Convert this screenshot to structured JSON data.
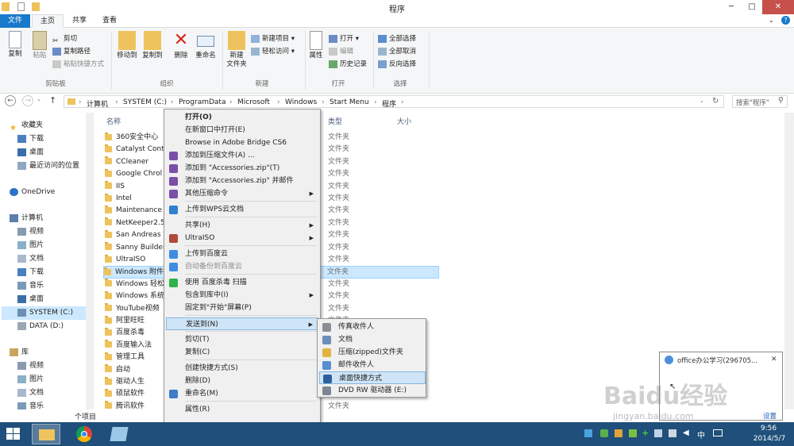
{
  "window": {
    "title": "程序",
    "min": "─",
    "max": "□",
    "close": "✕"
  },
  "tabs": [
    "文件",
    "主页",
    "共享",
    "查看"
  ],
  "ribbon": {
    "clipboard": {
      "copy": "复制",
      "paste": "粘贴",
      "cut": "剪切",
      "copy_path": "复制路径",
      "paste_shortcut": "粘贴快捷方式",
      "group": "剪贴板"
    },
    "organize": {
      "move_to": "移动到",
      "copy_to": "复制到",
      "delete": "删除",
      "rename": "重命名",
      "group": "组织"
    },
    "new": {
      "new_folder": "新建\n文件夹",
      "new_item": "新建项目",
      "easy_access": "轻松访问",
      "group": "新建"
    },
    "open": {
      "properties": "属性",
      "open": "打开",
      "edit": "编辑",
      "history": "历史记录",
      "group": "打开"
    },
    "select": {
      "select_all": "全部选择",
      "select_none": "全部取消",
      "invert": "反向选择",
      "group": "选择"
    }
  },
  "address": {
    "crumbs": [
      "计算机",
      "SYSTEM (C:)",
      "ProgramData",
      "Microsoft",
      "Windows",
      "Start Menu",
      "程序"
    ],
    "search_placeholder": "搜索\"程序\""
  },
  "nav": {
    "items": [
      "收藏夹",
      "下载",
      "桌面",
      "最近访问的位置",
      "OneDrive",
      "计算机",
      "视频",
      "图片",
      "文档",
      "下载",
      "音乐",
      "桌面",
      "SYSTEM (C:)",
      "DATA (D:)",
      "库",
      "视频",
      "图片",
      "文档",
      "音乐"
    ]
  },
  "columns": {
    "name": "名称",
    "type": "类型",
    "size": "大小"
  },
  "files": [
    {
      "name": "360安全中心",
      "type": "文件夹"
    },
    {
      "name": "Catalyst Cont",
      "type": "文件夹"
    },
    {
      "name": "CCleaner",
      "type": "文件夹"
    },
    {
      "name": "Google Chrol",
      "type": "文件夹"
    },
    {
      "name": "IIS",
      "type": "文件夹"
    },
    {
      "name": "Intel",
      "type": "文件夹"
    },
    {
      "name": "Maintenance",
      "type": "文件夹"
    },
    {
      "name": "NetKeeper2.5",
      "type": "文件夹"
    },
    {
      "name": "San Andreas",
      "type": "文件夹"
    },
    {
      "name": "Sanny Builder",
      "type": "文件夹"
    },
    {
      "name": "UltraISO",
      "type": "文件夹"
    },
    {
      "name": "Windows 附件",
      "type": "文件夹"
    },
    {
      "name": "Windows 轻松",
      "type": "文件夹"
    },
    {
      "name": "Windows 系统",
      "type": "文件夹"
    },
    {
      "name": "YouTube视频",
      "type": "文件夹"
    },
    {
      "name": "阿里旺旺",
      "type": "文件夹"
    },
    {
      "name": "百度杀毒",
      "type": "文件夹"
    },
    {
      "name": "百度输入法",
      "type": "文件夹"
    },
    {
      "name": "管理工具",
      "type": "文件夹"
    },
    {
      "name": "启动",
      "type": "文件夹"
    },
    {
      "name": "驱动人生",
      "type": "文件夹"
    },
    {
      "name": "硕鼠软件",
      "type": "文件夹"
    },
    {
      "name": "腾讯软件",
      "type": "文件夹"
    }
  ],
  "status": {
    "count": "个项目"
  },
  "context_menu": [
    {
      "label": "打开(O)",
      "bold": true
    },
    {
      "label": "在新窗口中打开(E)"
    },
    {
      "label": "Browse in Adobe Bridge CS6"
    },
    {
      "label": "添加到压缩文件(A) ...",
      "icon": "winrar-icon"
    },
    {
      "label": "添加到 \"Accessories.zip\"(T)",
      "icon": "winrar-icon"
    },
    {
      "label": "添加到 \"Accessories.zip\" 并邮件",
      "icon": "winrar-icon"
    },
    {
      "label": "其他压缩命令",
      "icon": "winrar-icon",
      "sub": true
    },
    {
      "sep": true
    },
    {
      "label": "上传到WPS云文档",
      "icon": "wps-cloud-icon"
    },
    {
      "sep": true
    },
    {
      "label": "共享(H)",
      "sub": true
    },
    {
      "label": "UltraISO",
      "icon": "ultraiso-icon",
      "sub": true
    },
    {
      "sep": true
    },
    {
      "label": "上传到百度云",
      "icon": "baidu-cloud-icon"
    },
    {
      "label": "自动备份到百度云",
      "icon": "baidu-cloud-icon",
      "disabled": true
    },
    {
      "sep": true
    },
    {
      "label": "使用 百度杀毒 扫描",
      "icon": "baidu-antivirus-icon"
    },
    {
      "label": "包含到库中(I)",
      "sub": true
    },
    {
      "label": "固定到\"开始\"屏幕(P)"
    },
    {
      "sep": true
    },
    {
      "label": "发送到(N)",
      "sub": true,
      "selected": true
    },
    {
      "sep": true
    },
    {
      "label": "剪切(T)"
    },
    {
      "label": "复制(C)"
    },
    {
      "sep": true
    },
    {
      "label": "创建快捷方式(S)"
    },
    {
      "label": "删除(D)"
    },
    {
      "label": "重命名(M)",
      "icon": "shield-icon"
    },
    {
      "sep": true
    },
    {
      "label": "属性(R)"
    }
  ],
  "send_to": [
    {
      "label": "传真收件人",
      "icon": "fax-icon"
    },
    {
      "label": "文档",
      "icon": "documents-icon"
    },
    {
      "label": "压缩(zipped)文件夹",
      "icon": "zip-folder-icon"
    },
    {
      "label": "邮件收件人",
      "icon": "mail-icon"
    },
    {
      "label": "桌面快捷方式",
      "icon": "desktop-icon",
      "selected": true
    },
    {
      "label": "DVD RW 驱动器 (E:)",
      "icon": "dvd-drive-icon"
    }
  ],
  "notification": {
    "title": "office办公学习(296705...",
    "settings": "设置",
    "watermark": "Baidu经验",
    "watermark_url": "jingyan.baidu.com"
  },
  "taskbar": {
    "time": "9:56",
    "date": "2014/5/7",
    "ime": "中"
  }
}
